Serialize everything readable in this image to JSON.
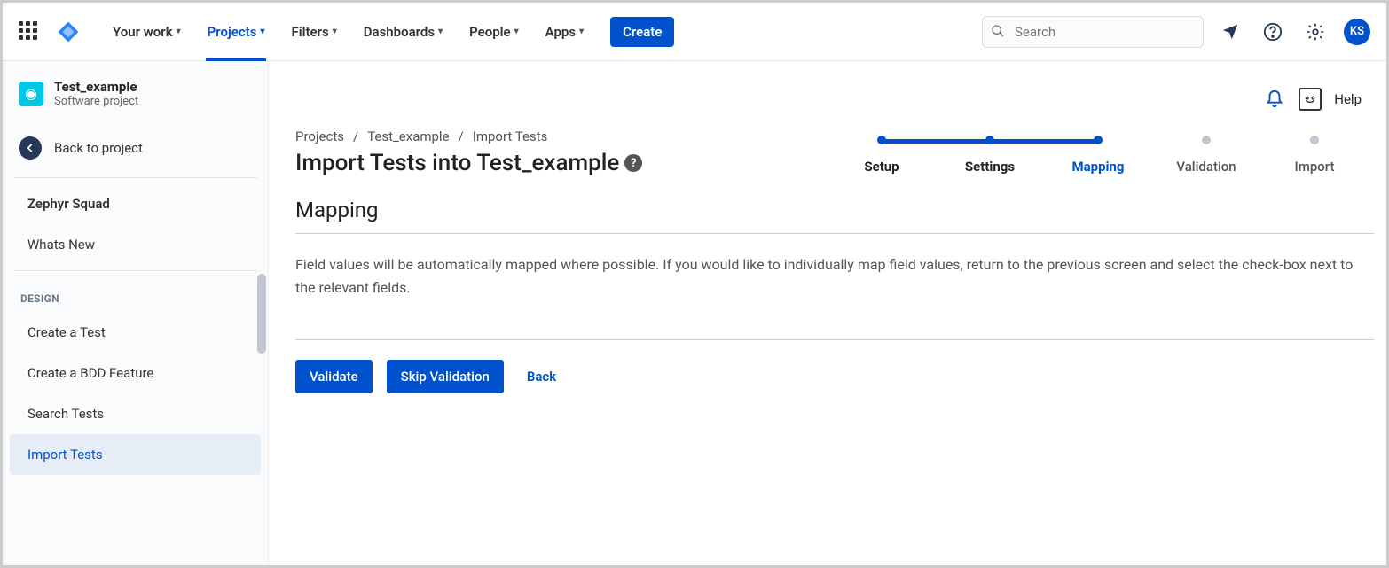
{
  "topnav": {
    "items": [
      "Your work",
      "Projects",
      "Filters",
      "Dashboards",
      "People",
      "Apps"
    ],
    "active_index": 1,
    "create": "Create",
    "search_placeholder": "Search",
    "avatar_initials": "KS"
  },
  "sidebar": {
    "project_name": "Test_example",
    "project_type": "Software project",
    "back_label": "Back to project",
    "app_name": "Zephyr Squad",
    "whats_new": "Whats New",
    "design_heading": "DESIGN",
    "design_items": [
      "Create a Test",
      "Create a BDD Feature",
      "Search Tests",
      "Import Tests"
    ],
    "design_active_index": 3
  },
  "breadcrumb": {
    "items": [
      "Projects",
      "Test_example",
      "Import Tests"
    ]
  },
  "page": {
    "title": "Import Tests into Test_example",
    "help_label": "Help",
    "section_title": "Mapping",
    "description": "Field values will be automatically mapped where possible. If you would like to individually map field values, return to the previous screen and select the check-box next to the relevant fields.",
    "validate_btn": "Validate",
    "skip_btn": "Skip Validation",
    "back_btn": "Back"
  },
  "stepper": {
    "steps": [
      "Setup",
      "Settings",
      "Mapping",
      "Validation",
      "Import"
    ],
    "active_index": 2
  }
}
